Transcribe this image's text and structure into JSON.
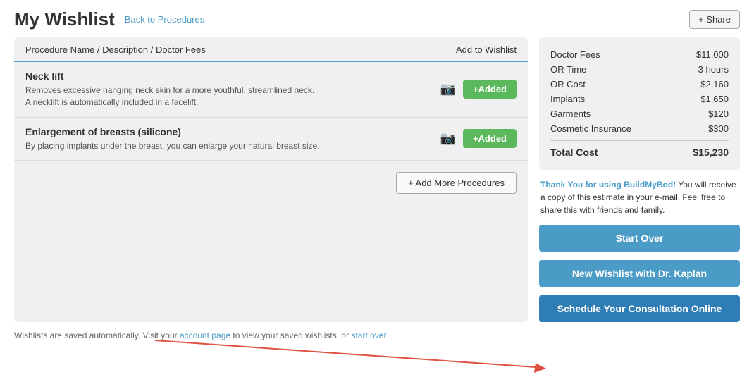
{
  "header": {
    "title": "My Wishlist",
    "back_link": "Back to Procedures",
    "share_label": "+ Share"
  },
  "table": {
    "col_left": "Procedure Name / Description / Doctor Fees",
    "col_right": "Add to Wishlist",
    "procedures": [
      {
        "name": "Neck lift",
        "description": "Removes excessive hanging neck skin for a more youthful, streamlined neck. A necklift is automatically included in a facelift.",
        "button_label": "+Added"
      },
      {
        "name": "Enlargement of breasts (silicone)",
        "description": "By placing implants under the breast, you can enlarge your natural breast size.",
        "button_label": "+Added"
      }
    ],
    "add_more_label": "+ Add More Procedures"
  },
  "costs": {
    "rows": [
      {
        "label": "Doctor Fees",
        "value": "$11,000"
      },
      {
        "label": "OR Time",
        "value": "3 hours"
      },
      {
        "label": "OR Cost",
        "value": "$2,160"
      },
      {
        "label": "Implants",
        "value": "$1,650"
      },
      {
        "label": "Garments",
        "value": "$120"
      },
      {
        "label": "Cosmetic Insurance",
        "value": "$300"
      }
    ],
    "total_label": "Total Cost",
    "total_value": "$15,230"
  },
  "thank_you": {
    "brand": "Thank You for using BuildMyBod!",
    "message": " You will receive a copy of this estimate in your e-mail. Feel free to share this with friends and family."
  },
  "actions": {
    "start_over": "Start Over",
    "new_wishlist": "New Wishlist with Dr. Kaplan",
    "schedule": "Schedule Your Consultation Online"
  },
  "bottom_note": {
    "prefix": "Wishlists are saved automatically. Visit your ",
    "account_link": "account page",
    "middle": " to view your saved wishlists, or ",
    "start_over_link": "start over"
  },
  "icons": {
    "plus_circle": "⊕",
    "camera": "📷"
  }
}
